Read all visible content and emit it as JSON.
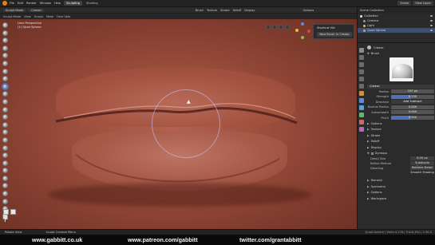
{
  "topbar": {
    "menus": [
      "File",
      "Edit",
      "Render",
      "Window",
      "Help"
    ],
    "tabs": [
      "Sculpting",
      "Shading"
    ],
    "active_tab": "Sculpting",
    "scene": "Scene",
    "view_layer": "View Layer"
  },
  "header2": {
    "mode": "Sculpt Mode",
    "items": [
      "Crease",
      "Brush",
      "Texture",
      "Stroke",
      "Falloff",
      "Display",
      "Options"
    ]
  },
  "header3": {
    "items": [
      "Sculpt Mode",
      "View",
      "Sculpt",
      "Mask",
      "Face Sets"
    ]
  },
  "viewport": {
    "info_line1": "User Perspective",
    "info_line2": "(1) Quad Sphere"
  },
  "popup": {
    "title": "Shortcut VUr",
    "button": "New Brush in Crease"
  },
  "outliner": {
    "header": "Scene Collection",
    "rows": [
      {
        "label": "Collection",
        "color": "#e8e8e8"
      },
      {
        "label": "Camera",
        "color": "#7fb34d"
      },
      {
        "label": "Light",
        "color": "#e8c04d"
      },
      {
        "label": "Quad Sphere",
        "color": "#e8974d"
      }
    ],
    "selected_index": 3
  },
  "props": {
    "brush_name": "Crease",
    "brush_section": "Brush",
    "crease_label": "Crease",
    "fields": [
      {
        "label": "Radius",
        "value": "107 px"
      },
      {
        "label": "Strength",
        "value": "0.230"
      },
      {
        "label": "Direction",
        "value": "Add  Subtract"
      },
      {
        "label": "Normal Radius",
        "value": "0.500"
      },
      {
        "label": "Autosmooth",
        "value": "0.000"
      },
      {
        "label": "Pinch",
        "value": "0.500"
      }
    ],
    "sections": [
      "Options",
      "Texture",
      "Stroke",
      "Falloff",
      "Display",
      "Dyntopo"
    ],
    "dyntopo": [
      {
        "label": "Detail Size",
        "value": "8.00 px"
      },
      {
        "label": "Refine Method",
        "value": "Subdivide Collapse"
      },
      {
        "label": "Detailing",
        "value": "Relative Detail"
      },
      {
        "label": "",
        "value": "Smooth Shading"
      }
    ],
    "tail_sections": [
      "Remesh",
      "Symmetry",
      "Options",
      "Workspace"
    ]
  },
  "statusbar": {
    "items": [
      "Rotate View",
      "Sculpt Context Menu"
    ],
    "info": "Quad Sphere | Verts:4,178 | Tris:8,352 | 2.90.0"
  },
  "credits": {
    "site1": "www.gabbitt.co.uk",
    "site2": "www.patreon.com/gabbitt",
    "site3": "twitter.com/grantabbitt"
  },
  "colors": {
    "accent": "#4f72b6",
    "blender_orange": "#e87d0d",
    "skin_base": "#9a4d3c"
  }
}
